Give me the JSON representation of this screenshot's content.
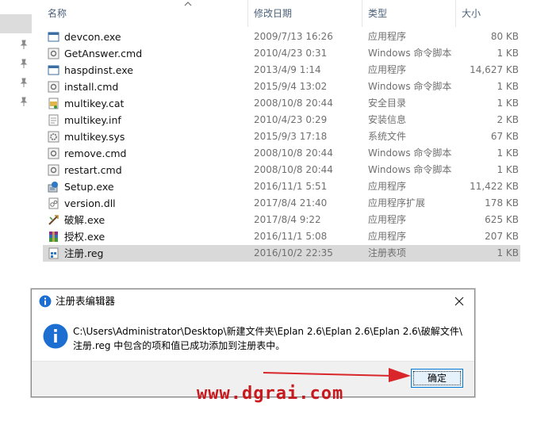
{
  "columns": {
    "name": "名称",
    "date": "修改日期",
    "type": "类型",
    "size": "大小"
  },
  "files": [
    {
      "name": "devcon.exe",
      "date": "2009/7/13 16:26",
      "type": "应用程序",
      "size": "80 KB",
      "icon": "exe-window-icon"
    },
    {
      "name": "GetAnswer.cmd",
      "date": "2010/4/23 0:31",
      "type": "Windows 命令脚本",
      "size": "1 KB",
      "icon": "cmd-script-icon"
    },
    {
      "name": "haspdinst.exe",
      "date": "2013/4/9 1:14",
      "type": "应用程序",
      "size": "14,627 KB",
      "icon": "exe-window-icon"
    },
    {
      "name": "install.cmd",
      "date": "2015/9/4 13:02",
      "type": "Windows 命令脚本",
      "size": "1 KB",
      "icon": "cmd-script-icon"
    },
    {
      "name": "multikey.cat",
      "date": "2008/10/8 20:44",
      "type": "安全目录",
      "size": "1 KB",
      "icon": "security-catalog-icon"
    },
    {
      "name": "multikey.inf",
      "date": "2010/4/23 0:29",
      "type": "安装信息",
      "size": "2 KB",
      "icon": "setup-info-icon"
    },
    {
      "name": "multikey.sys",
      "date": "2015/9/3 17:18",
      "type": "系统文件",
      "size": "67 KB",
      "icon": "system-file-icon"
    },
    {
      "name": "remove.cmd",
      "date": "2008/10/8 20:44",
      "type": "Windows 命令脚本",
      "size": "1 KB",
      "icon": "cmd-script-icon"
    },
    {
      "name": "restart.cmd",
      "date": "2008/10/8 20:44",
      "type": "Windows 命令脚本",
      "size": "1 KB",
      "icon": "cmd-script-icon"
    },
    {
      "name": "Setup.exe",
      "date": "2016/11/1 5:51",
      "type": "应用程序",
      "size": "11,422 KB",
      "icon": "setup-exe-icon"
    },
    {
      "name": "version.dll",
      "date": "2017/8/4 21:40",
      "type": "应用程序扩展",
      "size": "178 KB",
      "icon": "dll-file-icon"
    },
    {
      "name": "破解.exe",
      "date": "2017/8/4 9:22",
      "type": "应用程序",
      "size": "625 KB",
      "icon": "crack-tool-icon"
    },
    {
      "name": "授权.exe",
      "date": "2016/11/1 5:08",
      "type": "应用程序",
      "size": "207 KB",
      "icon": "winrar-sfx-icon"
    },
    {
      "name": "注册.reg",
      "date": "2016/10/2 22:35",
      "type": "注册表项",
      "size": "1 KB",
      "icon": "registry-file-icon",
      "selected": true
    }
  ],
  "dialog": {
    "title": "注册表编辑器",
    "message_line1": "C:\\Users\\Administrator\\Desktop\\新建文件夹\\Eplan 2.6\\Eplan 2.6\\Eplan 2.6\\破解文件\\",
    "message_line2": "注册.reg 中包含的项和值已成功添加到注册表中。",
    "ok_label": "确定"
  },
  "watermark": "www.dgrai.com",
  "colors": {
    "selection": "#d9d9d9",
    "header_text": "#4c607a",
    "info_blue": "#1c6fd1",
    "watermark_red": "#c8191e",
    "button_border": "#0078d7",
    "button_fill": "#e5f1fb"
  }
}
